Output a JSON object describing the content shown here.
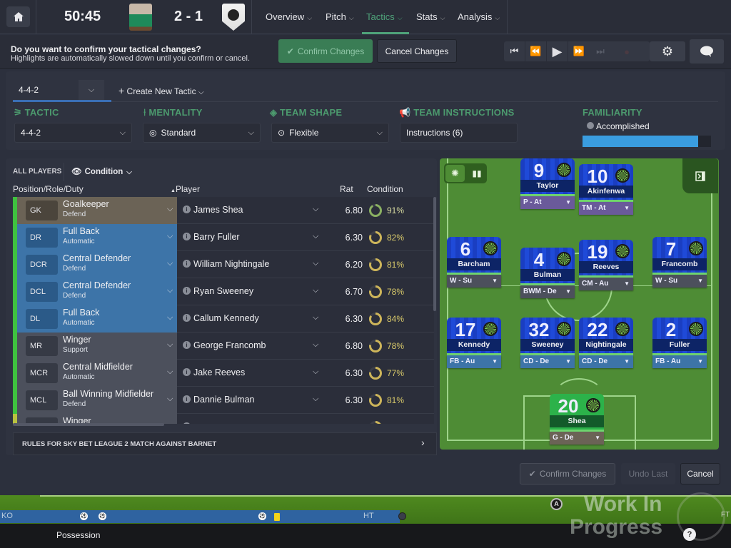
{
  "header": {
    "clock": "50:45",
    "score": "2 - 1",
    "home_crest": "home-team-crest",
    "away_crest": "away-team-crest",
    "nav": [
      {
        "label": "Overview",
        "active": false
      },
      {
        "label": "Pitch",
        "active": false
      },
      {
        "label": "Tactics",
        "active": true
      },
      {
        "label": "Stats",
        "active": false
      },
      {
        "label": "Analysis",
        "active": false
      }
    ]
  },
  "confirm_bar": {
    "question": "Do you want to confirm your tactical changes?",
    "subtext": "Highlights are automatically slowed down until you confirm or cancel.",
    "confirm_label": "Confirm Changes",
    "cancel_label": "Cancel Changes"
  },
  "playback": {
    "icons": [
      "skip-start-icon",
      "rewind-icon",
      "play-icon",
      "fast-forward-icon",
      "skip-end-icon"
    ],
    "settings_icon": "gear-icon",
    "chat_icon": "chat-bubble-icon"
  },
  "tactic": {
    "selected_tactic_tab": "4-4-2",
    "create_new_label": "Create New Tactic",
    "sections": {
      "tactic": {
        "heading": "TACTIC",
        "value": "4-4-2"
      },
      "mentality": {
        "heading": "MENTALITY",
        "value": "Standard"
      },
      "team_shape": {
        "heading": "TEAM SHAPE",
        "value": "Flexible"
      },
      "team_instructions": {
        "heading": "TEAM INSTRUCTIONS",
        "value": "Instructions (6)"
      },
      "familiarity": {
        "heading": "FAMILIARITY",
        "value": "Accomplished",
        "progress": 0.9
      }
    }
  },
  "player_list": {
    "filter_label": "ALL PLAYERS",
    "view_label": "Condition",
    "columns": {
      "position": "Position/Role/Duty",
      "player": "Player",
      "rating": "Rat",
      "condition": "Condition"
    },
    "rows": [
      {
        "code": "GK",
        "role": "Goalkeeper",
        "duty": "Defend",
        "player": "James Shea",
        "rating": "6.80",
        "condition": "91%",
        "cond_value": 0.91,
        "group": "gk"
      },
      {
        "code": "DR",
        "role": "Full Back",
        "duty": "Automatic",
        "player": "Barry Fuller",
        "rating": "6.30",
        "condition": "82%",
        "cond_value": 0.82,
        "group": "def"
      },
      {
        "code": "DCR",
        "role": "Central Defender",
        "duty": "Defend",
        "player": "William Nightingale",
        "rating": "6.20",
        "condition": "81%",
        "cond_value": 0.81,
        "group": "def"
      },
      {
        "code": "DCL",
        "role": "Central Defender",
        "duty": "Defend",
        "player": "Ryan Sweeney",
        "rating": "6.70",
        "condition": "78%",
        "cond_value": 0.78,
        "group": "def"
      },
      {
        "code": "DL",
        "role": "Full Back",
        "duty": "Automatic",
        "player": "Callum Kennedy",
        "rating": "6.30",
        "condition": "84%",
        "cond_value": 0.84,
        "group": "def"
      },
      {
        "code": "MR",
        "role": "Winger",
        "duty": "Support",
        "player": "George Francomb",
        "rating": "6.80",
        "condition": "78%",
        "cond_value": 0.78,
        "group": "mid"
      },
      {
        "code": "MCR",
        "role": "Central Midfielder",
        "duty": "Automatic",
        "player": "Jake Reeves",
        "rating": "6.30",
        "condition": "77%",
        "cond_value": 0.77,
        "group": "mid"
      },
      {
        "code": "MCL",
        "role": "Ball Winning Midfielder",
        "duty": "Defend",
        "player": "Dannie Bulman",
        "rating": "6.30",
        "condition": "81%",
        "cond_value": 0.81,
        "group": "mid"
      },
      {
        "code": "",
        "role": "Winger",
        "duty": "",
        "player": "",
        "rating": "",
        "condition": "",
        "cond_value": 0.7,
        "group": "mid"
      }
    ],
    "rules_label": "RULES FOR SKY BET LEAGUE 2 MATCH AGAINST BARNET"
  },
  "pitch": {
    "players": [
      {
        "number": "9",
        "name": "Taylor",
        "role": "P - At",
        "type": "att"
      },
      {
        "number": "10",
        "name": "Akinfenwa",
        "role": "TM - At",
        "type": "att"
      },
      {
        "number": "6",
        "name": "Barcham",
        "role": "W - Su",
        "type": "mid"
      },
      {
        "number": "4",
        "name": "Bulman",
        "role": "BWM - De",
        "type": "mid"
      },
      {
        "number": "19",
        "name": "Reeves",
        "role": "CM - Au",
        "type": "mid"
      },
      {
        "number": "7",
        "name": "Francomb",
        "role": "W - Su",
        "type": "mid"
      },
      {
        "number": "17",
        "name": "Kennedy",
        "role": "FB - Au",
        "type": "def"
      },
      {
        "number": "32",
        "name": "Sweeney",
        "role": "CD - De",
        "type": "def"
      },
      {
        "number": "22",
        "name": "Nightingale",
        "role": "CD - De",
        "type": "def"
      },
      {
        "number": "2",
        "name": "Fuller",
        "role": "FB - Au",
        "type": "def"
      },
      {
        "number": "20",
        "name": "Shea",
        "role": "G - De",
        "type": "gk"
      }
    ]
  },
  "actions": {
    "confirm_label": "Confirm Changes",
    "undo_label": "Undo Last",
    "cancel_label": "Cancel"
  },
  "timeline": {
    "start": "KO",
    "half": "HT",
    "end": "FT",
    "possession_label": "Possession"
  },
  "watermark": {
    "line1": "Work In",
    "line2": "Progress"
  },
  "colors": {
    "accent_green": "#4fa37a",
    "familiarity_blue": "#3a9de0",
    "condition_yellow": "#d8c96a"
  }
}
